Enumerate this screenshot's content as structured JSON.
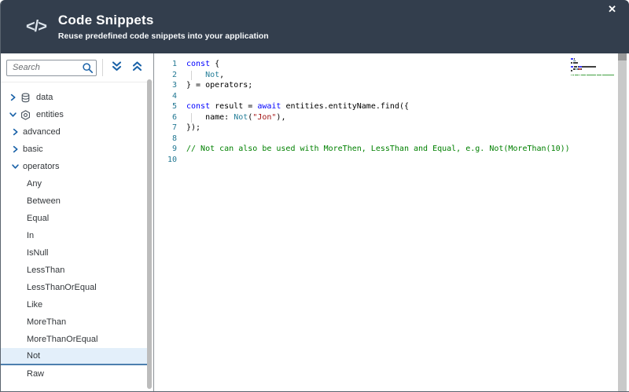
{
  "header": {
    "title": "Code Snippets",
    "subtitle": "Reuse predefined code snippets into your application",
    "code_icon": "</>",
    "close_label": "✕"
  },
  "sidebar": {
    "search_placeholder": "Search",
    "tree": [
      {
        "label": "data",
        "level": 1,
        "icon": "database",
        "chevron": "collapsed"
      },
      {
        "label": "entities",
        "level": 1,
        "icon": "entity",
        "chevron": "expanded"
      },
      {
        "label": "advanced",
        "level": 2,
        "chevron": "collapsed"
      },
      {
        "label": "basic",
        "level": 2,
        "chevron": "collapsed"
      },
      {
        "label": "operators",
        "level": 2,
        "chevron": "expanded"
      },
      {
        "label": "Any",
        "level": 3
      },
      {
        "label": "Between",
        "level": 3
      },
      {
        "label": "Equal",
        "level": 3
      },
      {
        "label": "In",
        "level": 3
      },
      {
        "label": "IsNull",
        "level": 3
      },
      {
        "label": "LessThan",
        "level": 3
      },
      {
        "label": "LessThanOrEqual",
        "level": 3
      },
      {
        "label": "Like",
        "level": 3
      },
      {
        "label": "MoreThan",
        "level": 3
      },
      {
        "label": "MoreThanOrEqual",
        "level": 3
      },
      {
        "label": "Not",
        "level": 3,
        "selected": true
      },
      {
        "label": "Raw",
        "level": 3
      }
    ]
  },
  "editor": {
    "lines": [
      {
        "num": 1,
        "tokens": [
          [
            "k",
            "const"
          ],
          [
            "p",
            " {"
          ]
        ]
      },
      {
        "num": 2,
        "guide": true,
        "tokens": [
          [
            "p",
            "    "
          ],
          [
            "t",
            "Not"
          ],
          [
            "p",
            ","
          ]
        ]
      },
      {
        "num": 3,
        "tokens": [
          [
            "p",
            "} = operators;"
          ]
        ]
      },
      {
        "num": 4,
        "tokens": []
      },
      {
        "num": 5,
        "tokens": [
          [
            "k",
            "const"
          ],
          [
            "p",
            " result = "
          ],
          [
            "k",
            "await"
          ],
          [
            "p",
            " entities.entityName.find({"
          ]
        ]
      },
      {
        "num": 6,
        "guide": true,
        "tokens": [
          [
            "p",
            "    name: "
          ],
          [
            "t",
            "Not"
          ],
          [
            "p",
            "("
          ],
          [
            "s",
            "\"Jon\""
          ],
          [
            "p",
            "),"
          ]
        ]
      },
      {
        "num": 7,
        "tokens": [
          [
            "p",
            "});"
          ]
        ]
      },
      {
        "num": 8,
        "tokens": []
      },
      {
        "num": 9,
        "tokens": [
          [
            "c",
            "// Not can also be used with MoreThen, LessThan and Equal, e.g. Not(MoreThan(10))"
          ]
        ]
      },
      {
        "num": 10,
        "tokens": []
      }
    ],
    "token_colors": {
      "k": "#0000ff",
      "t": "#267f99",
      "s": "#a31515",
      "c": "#008000",
      "p": "#000000"
    },
    "line_number_color": "#237893"
  },
  "colors": {
    "header_bg": "#333e4d",
    "accent_blue": "#1a62a8",
    "icon_gray": "#4a5560",
    "selected_bg": "#e3effa",
    "selected_border": "#4d7fae"
  }
}
